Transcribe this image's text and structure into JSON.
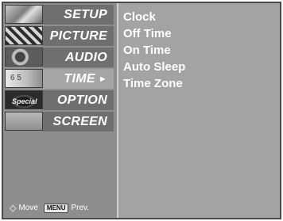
{
  "menu": {
    "items": [
      {
        "label": "SETUP",
        "thumb": "setup-thumbnail"
      },
      {
        "label": "PICTURE",
        "thumb": "picture-thumbnail"
      },
      {
        "label": "AUDIO",
        "thumb": "audio-thumbnail"
      },
      {
        "label": "TIME",
        "thumb": "time-thumbnail",
        "active": true
      },
      {
        "label": "OPTION",
        "thumb": "option-thumbnail"
      },
      {
        "label": "SCREEN",
        "thumb": "screen-thumbnail"
      }
    ],
    "active_arrow": "►",
    "thumb_texts": {
      "time": "6 5",
      "option": "Special"
    }
  },
  "submenu": {
    "items": [
      "Clock",
      "Off Time",
      "On Time",
      "Auto Sleep",
      "Time Zone"
    ]
  },
  "footer": {
    "move_icon": "◇",
    "move_label": "Move",
    "menu_key": "MENU",
    "prev_label": "Prev."
  }
}
